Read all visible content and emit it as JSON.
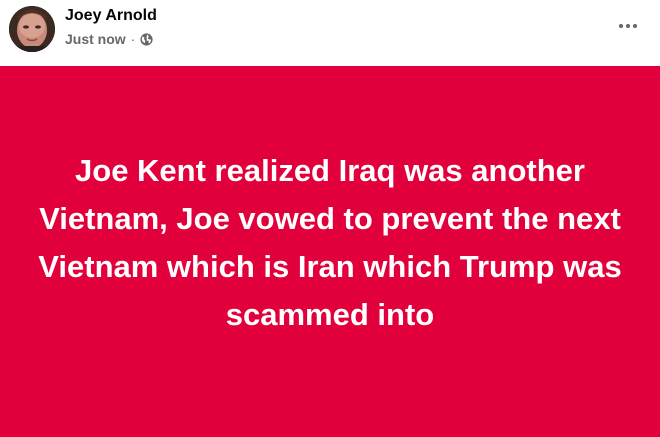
{
  "post": {
    "author": "Joey Arnold",
    "timestamp": "Just now",
    "separator": "·",
    "audience_icon": "globe-icon",
    "more_icon": "more-options-icon",
    "text": "Joe Kent realized Iraq was another Vietnam, Joe vowed to prevent the next Vietnam which is Iran which Trump was scammed into",
    "background_color": "#e1003c",
    "text_color": "#ffffff"
  }
}
